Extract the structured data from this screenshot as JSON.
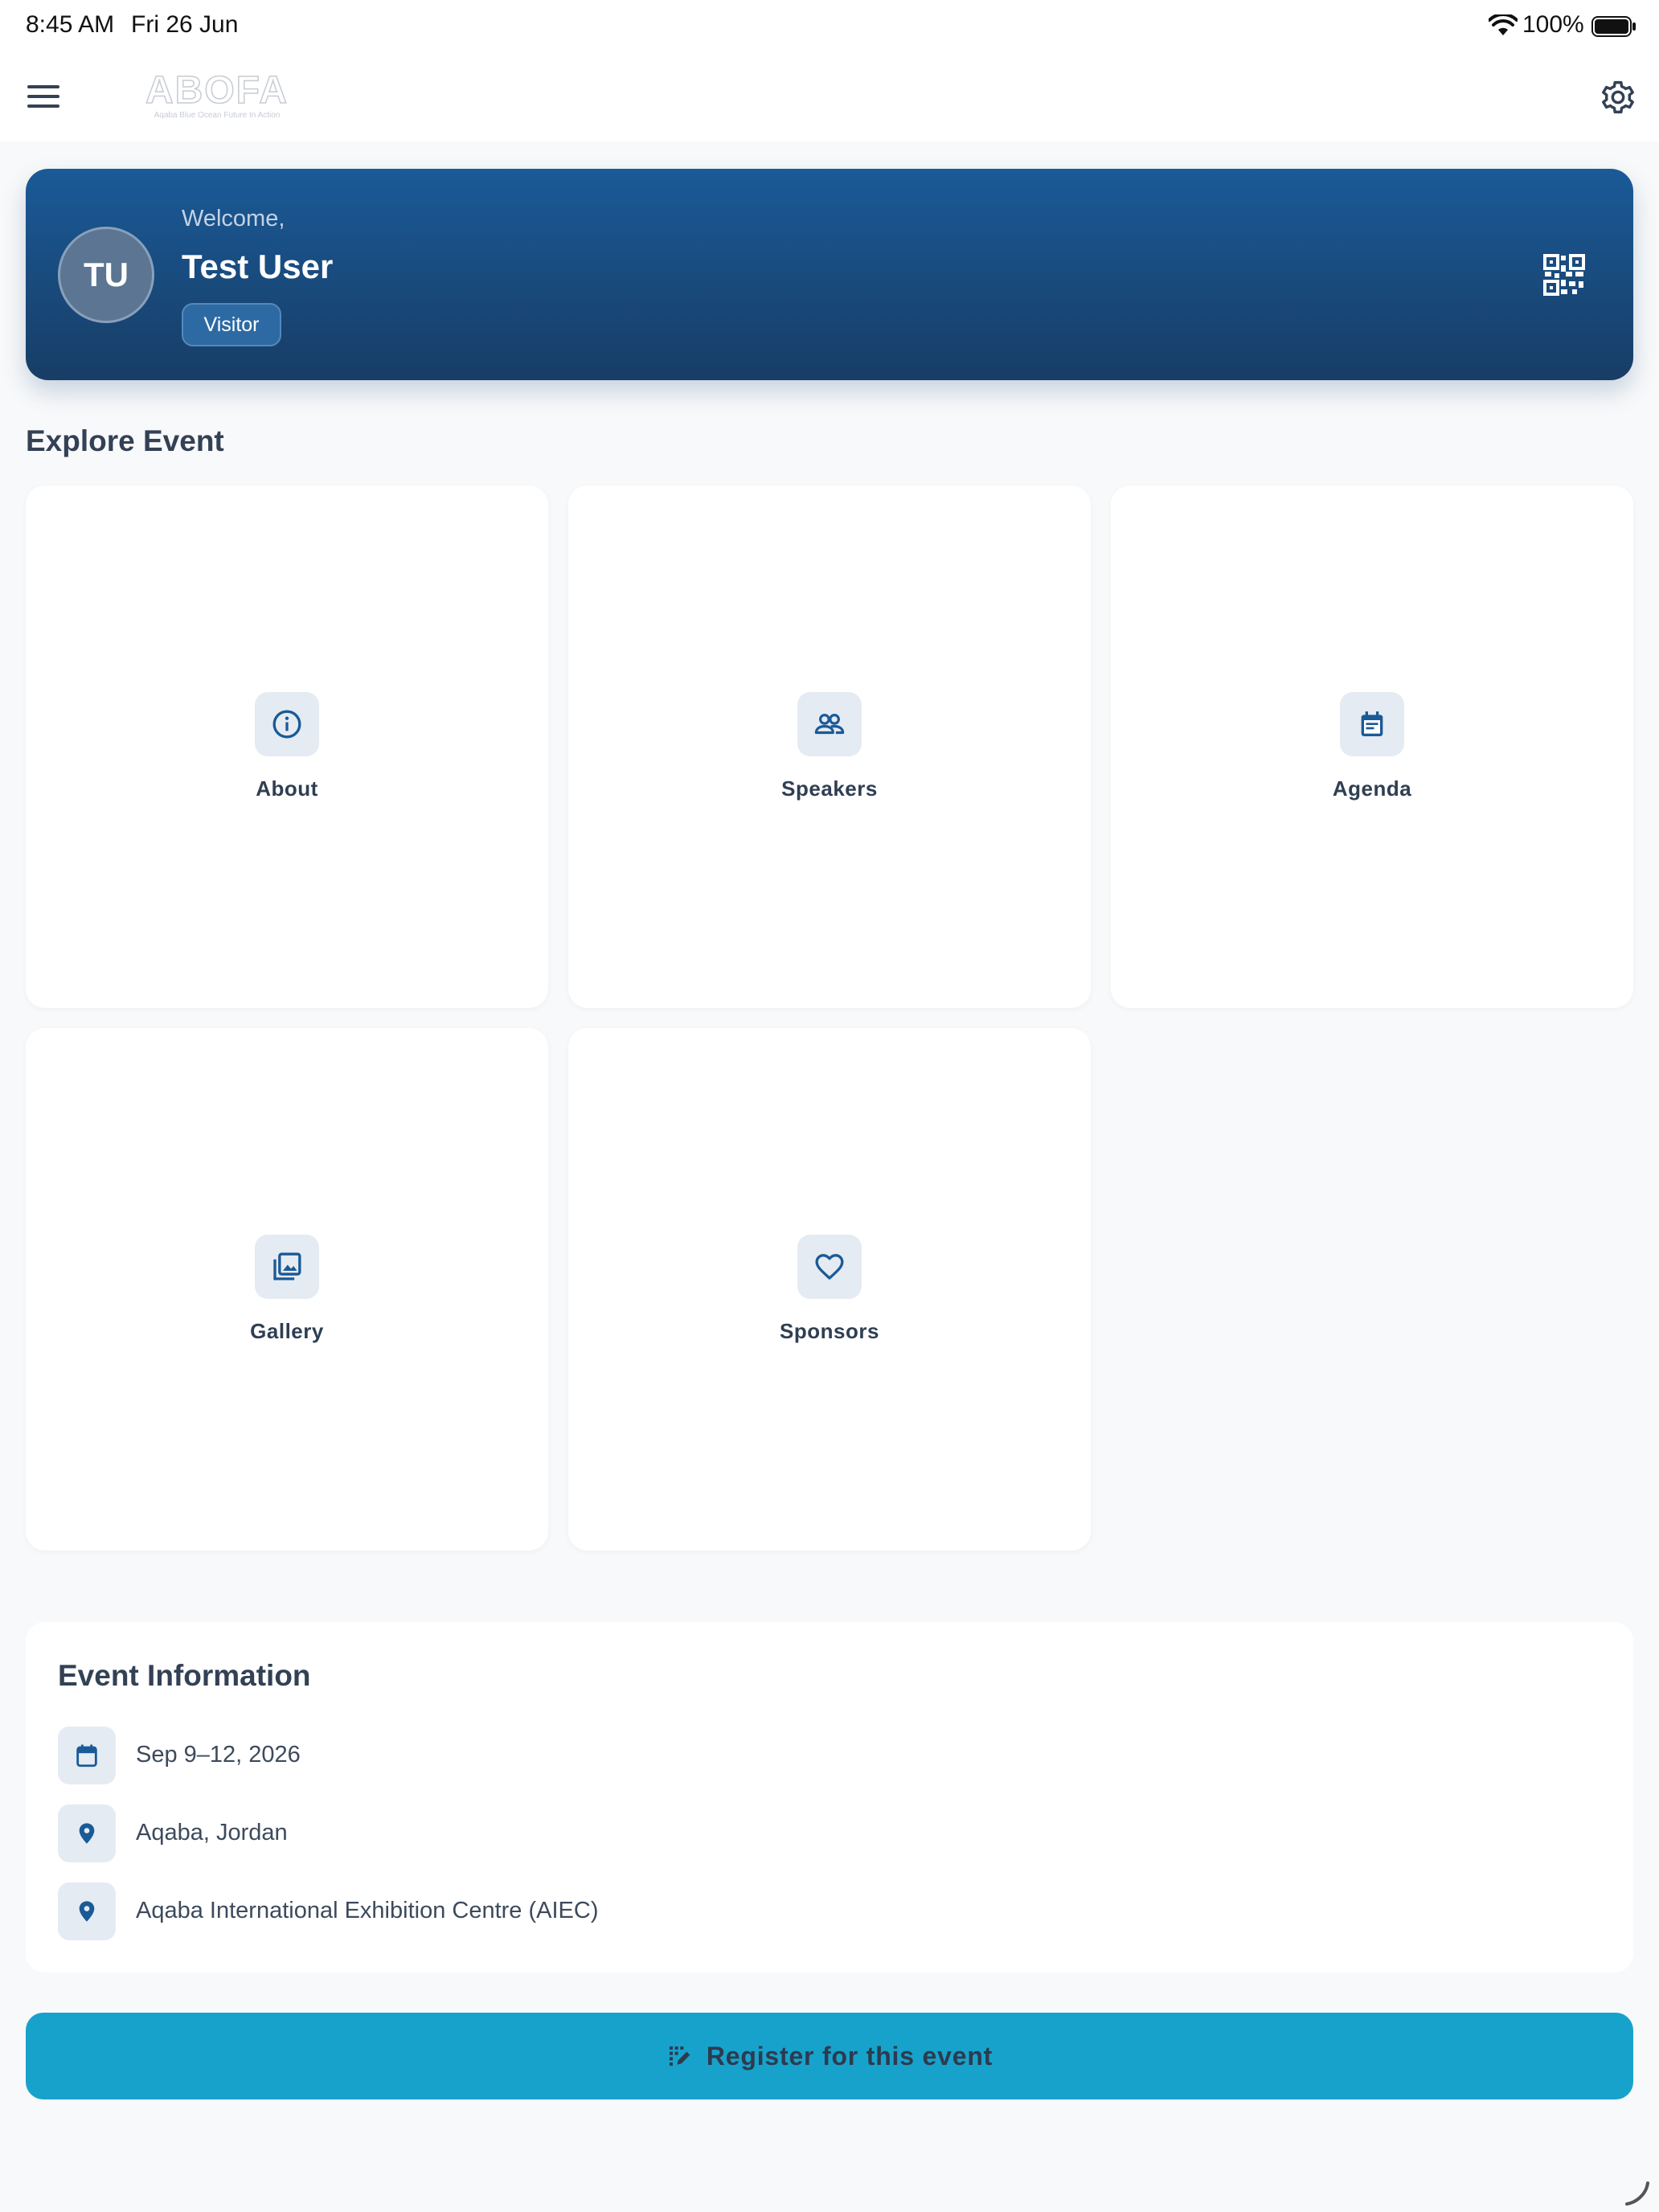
{
  "status_bar": {
    "time": "8:45 AM",
    "date": "Fri 26 Jun",
    "battery": "100%"
  },
  "app_bar": {
    "logo_text": "ABOFA",
    "logo_tagline": "Aqaba Blue Ocean Future In Action"
  },
  "welcome": {
    "greeting": "Welcome,",
    "initials": "TU",
    "name": "Test User",
    "role": "Visitor"
  },
  "explore": {
    "title": "Explore Event",
    "tiles": [
      {
        "label": "About",
        "icon": "info-icon"
      },
      {
        "label": "Speakers",
        "icon": "people-icon"
      },
      {
        "label": "Agenda",
        "icon": "agenda-icon"
      },
      {
        "label": "Gallery",
        "icon": "gallery-icon"
      },
      {
        "label": "Sponsors",
        "icon": "heart-icon"
      }
    ]
  },
  "event_info": {
    "title": "Event Information",
    "rows": [
      {
        "icon": "calendar-icon",
        "text": "Sep 9–12, 2026"
      },
      {
        "icon": "location-pin-icon",
        "text": "Aqaba, Jordan"
      },
      {
        "icon": "location-pin-icon",
        "text": "Aqaba International Exhibition Centre (AIEC)"
      }
    ]
  },
  "register_button": {
    "label": "Register for this event",
    "icon": "register-icon"
  },
  "colors": {
    "primary": "#1a5a97",
    "primary_dark": "#183d66",
    "accent": "#17a2cc",
    "icon_bg": "#e5ebf2",
    "background": "#f8f9fa"
  }
}
